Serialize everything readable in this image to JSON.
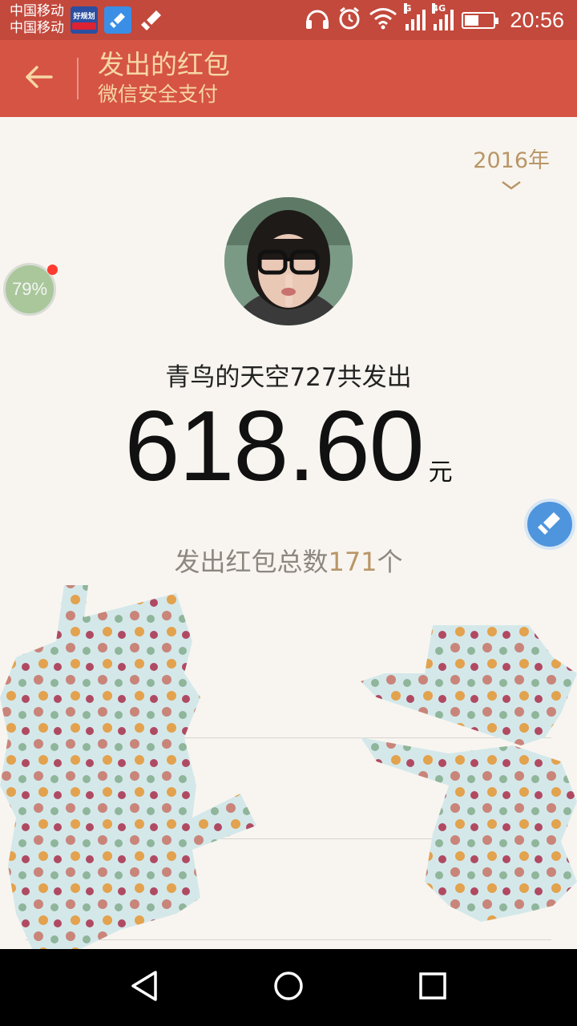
{
  "status_bar": {
    "carrier_1": "中国移动",
    "carrier_2": "中国移动",
    "app_icon_1_text": "好规划",
    "net_1": "G",
    "net_2": "4G",
    "battery_level": 0.5,
    "time": "20:56"
  },
  "title_bar": {
    "title": "发出的红包",
    "subtitle": "微信安全支付",
    "back_icon": "arrow-left-icon"
  },
  "year_selector": {
    "year": "2016年",
    "icon": "chevron-down-icon"
  },
  "summary": {
    "line": "青鸟的天空727共发出",
    "amount": "618.60",
    "currency": "元",
    "count_prefix": "发出红包总数",
    "count_value": "171",
    "count_suffix": "个"
  },
  "floating": {
    "battery_percent": "79%"
  },
  "colors": {
    "status_bar_bg": "#c2493c",
    "title_bar_bg": "#d65444",
    "title_text": "#f6d6a6",
    "gold": "#b99667",
    "page_bg": "#f8f5f0"
  },
  "nav_bar": {
    "back": "nav-back-icon",
    "home": "nav-home-icon",
    "recents": "nav-recents-icon"
  }
}
